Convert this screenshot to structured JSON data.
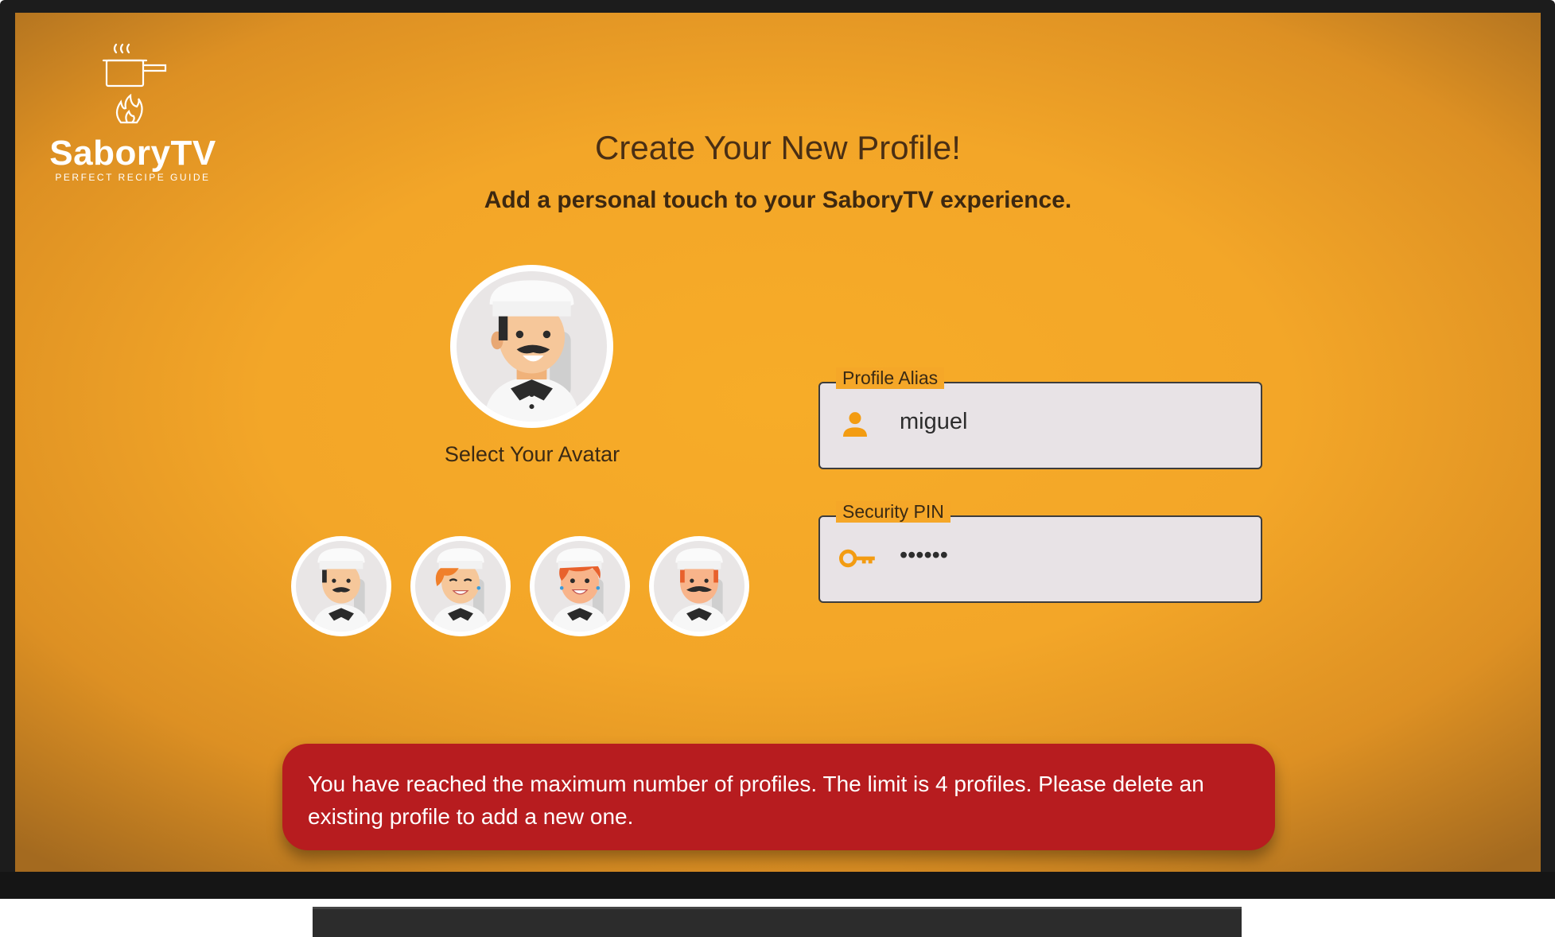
{
  "brand": {
    "title": "SaboryTV",
    "tagline": "PERFECT RECIPE GUIDE"
  },
  "header": {
    "title": "Create Your New Profile!",
    "subtitle": "Add a personal touch to your SaboryTV experience."
  },
  "avatar": {
    "select_label": "Select Your Avatar",
    "options": [
      {
        "name": "chef-man-mustache"
      },
      {
        "name": "chef-woman-ginger"
      },
      {
        "name": "chef-woman-redhead"
      },
      {
        "name": "chef-man-redhead-mustache"
      }
    ]
  },
  "form": {
    "alias": {
      "label": "Profile Alias",
      "value": "miguel",
      "icon": "person-icon"
    },
    "pin": {
      "label": "Security PIN",
      "value": "••••••",
      "icon": "key-icon"
    }
  },
  "error": {
    "message": "You have reached the maximum number of profiles. The limit is 4 profiles. Please delete an existing profile to add a new one."
  },
  "colors": {
    "background": "#f5a728",
    "error": "#b71c1f",
    "icon_accent": "#f39c12"
  }
}
